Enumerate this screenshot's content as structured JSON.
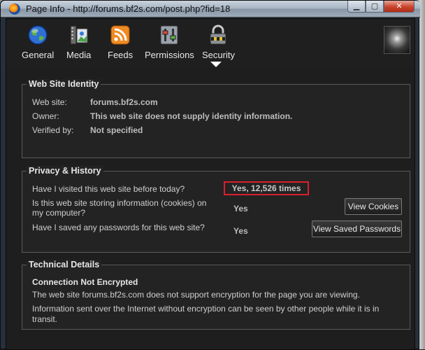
{
  "window": {
    "title": "Page Info - http://forums.bf2s.com/post.php?fid=18",
    "buttons": {
      "minimize": "▁",
      "maximize": "▢",
      "close": "✕"
    }
  },
  "toolbar": {
    "tabs": [
      {
        "label": "General",
        "icon": "globe-icon"
      },
      {
        "label": "Media",
        "icon": "media-icon"
      },
      {
        "label": "Feeds",
        "icon": "rss-feed-icon"
      },
      {
        "label": "Permissions",
        "icon": "permissions-icon"
      },
      {
        "label": "Security",
        "icon": "padlock-icon"
      }
    ],
    "selected": "Security"
  },
  "identity": {
    "title": "Web Site Identity",
    "website_label": "Web site:",
    "website_value": "forums.bf2s.com",
    "owner_label": "Owner:",
    "owner_value": "This web site does not supply identity information.",
    "verified_label": "Verified by:",
    "verified_value": "Not specified"
  },
  "privacy": {
    "title": "Privacy & History",
    "q_visited": "Have I visited this web site before today?",
    "a_visited": "Yes, 12,526 times",
    "q_cookies_line1": "Is this web site storing information (cookies) on",
    "q_cookies_line2": "my computer?",
    "a_cookies": "Yes",
    "view_cookies": "View Cookies",
    "q_passwords": "Have I saved any passwords for this web site?",
    "a_passwords": "Yes",
    "view_passwords": "View Saved Passwords"
  },
  "technical": {
    "title": "Technical Details",
    "heading": "Connection Not Encrypted",
    "line1": "The web site forums.bf2s.com does not support encryption for the page you are viewing.",
    "line2a": "Information sent over the Internet without encryption can be seen by other people while it is in",
    "line2b": "transit."
  },
  "colors": {
    "highlight_border": "#d8202e",
    "background": "#1e1e1e",
    "text": "#cfcfcf"
  }
}
